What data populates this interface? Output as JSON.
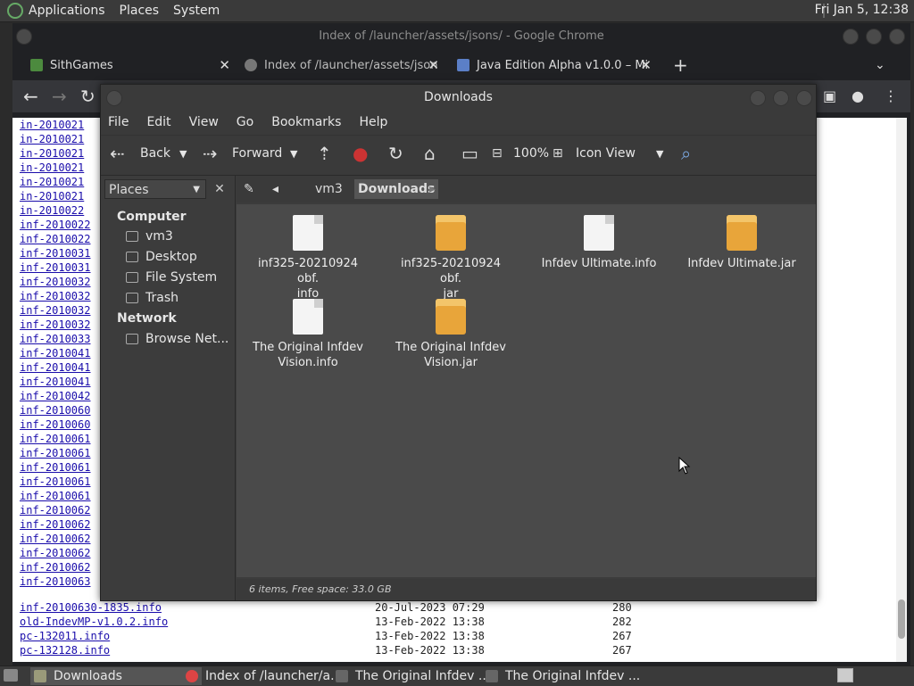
{
  "system_panel": {
    "menus": [
      "Applications",
      "Places",
      "System"
    ],
    "clock": "Fri Jan  5, 12:38"
  },
  "chrome": {
    "window_title": "Index of /launcher/assets/jsons/ - Google Chrome",
    "tabs": [
      {
        "label": "SithGames"
      },
      {
        "label": "Index of /launcher/assets/json"
      },
      {
        "label": "Java Edition Alpha v1.0.0 – Mi"
      }
    ],
    "new_tab": "+"
  },
  "webpage": {
    "links": [
      "in-2010021",
      "in-2010021",
      "in-2010021",
      "in-2010021",
      "in-2010021",
      "in-2010021",
      "in-2010022",
      "inf-2010022",
      "inf-2010022",
      "inf-2010031",
      "inf-2010031",
      "inf-2010032",
      "inf-2010032",
      "inf-2010032",
      "inf-2010032",
      "inf-2010033",
      "inf-2010041",
      "inf-2010041",
      "inf-2010041",
      "inf-2010042",
      "inf-2010060",
      "inf-2010060",
      "inf-2010061",
      "inf-2010061",
      "inf-2010061",
      "inf-2010061",
      "inf-2010061",
      "inf-2010062",
      "inf-2010062",
      "inf-2010062",
      "inf-2010062",
      "inf-2010062",
      "inf-2010063"
    ],
    "full_rows": [
      {
        "name": "inf-20100630-1835.info",
        "date": "20-Jul-2023 07:29",
        "size": "280"
      },
      {
        "name": "old-IndevMP-v1.0.2.info",
        "date": "13-Feb-2022 13:38",
        "size": "282"
      },
      {
        "name": "pc-132011.info",
        "date": "13-Feb-2022 13:38",
        "size": "267"
      },
      {
        "name": "pc-132128.info",
        "date": "13-Feb-2022 13:38",
        "size": "267"
      }
    ]
  },
  "file_manager": {
    "title": "Downloads",
    "menus": [
      "File",
      "Edit",
      "View",
      "Go",
      "Bookmarks",
      "Help"
    ],
    "toolbar": {
      "back": "Back",
      "forward": "Forward",
      "zoom": "100%",
      "view_mode": "Icon View"
    },
    "sidebar": {
      "combo": "Places",
      "computer_heading": "Computer",
      "computer_items": [
        "vm3",
        "Desktop",
        "File System",
        "Trash"
      ],
      "network_heading": "Network",
      "network_items": [
        "Browse Net..."
      ]
    },
    "path": [
      "vm3",
      "Downloads"
    ],
    "files": [
      {
        "name": "inf325-20210924 obf.\ninfo",
        "type": "info"
      },
      {
        "name": "inf325-20210924 obf.\njar",
        "type": "jar"
      },
      {
        "name": "Infdev Ultimate.info",
        "type": "info"
      },
      {
        "name": "Infdev Ultimate.jar",
        "type": "jar"
      },
      {
        "name": "The Original Infdev\nVision.info",
        "type": "info"
      },
      {
        "name": "The Original Infdev\nVision.jar",
        "type": "jar"
      }
    ],
    "status": "6 items, Free space: 33.0 GB"
  },
  "taskbar": {
    "items": [
      {
        "label": "Downloads"
      },
      {
        "label": "Index of /launcher/a..."
      },
      {
        "label": "The Original Infdev ..."
      },
      {
        "label": "The Original Infdev ..."
      }
    ]
  }
}
